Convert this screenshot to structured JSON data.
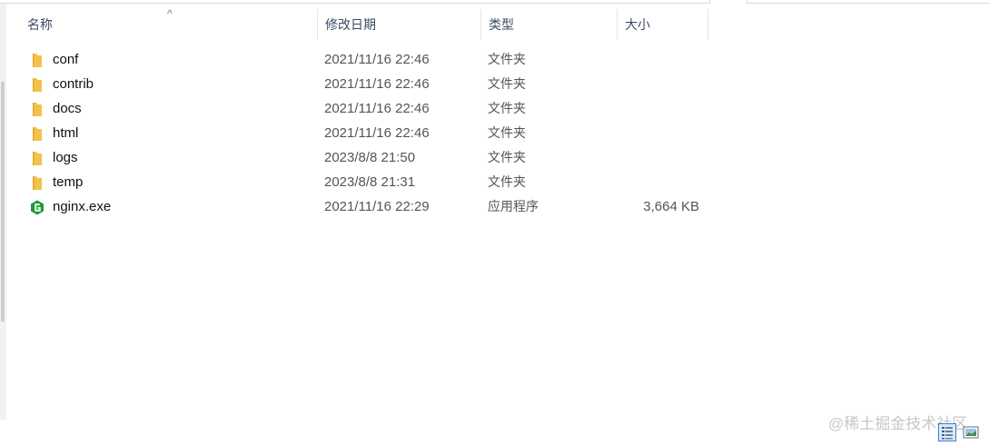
{
  "columns": {
    "name": "名称",
    "date_modified": "修改日期",
    "type": "类型",
    "size": "大小"
  },
  "sort_indicator": "^",
  "files": [
    {
      "name": "conf",
      "date": "2021/11/16 22:46",
      "type": "文件夹",
      "size": "",
      "icon": "folder-icon"
    },
    {
      "name": "contrib",
      "date": "2021/11/16 22:46",
      "type": "文件夹",
      "size": "",
      "icon": "folder-icon"
    },
    {
      "name": "docs",
      "date": "2021/11/16 22:46",
      "type": "文件夹",
      "size": "",
      "icon": "folder-icon"
    },
    {
      "name": "html",
      "date": "2021/11/16 22:46",
      "type": "文件夹",
      "size": "",
      "icon": "folder-icon"
    },
    {
      "name": "logs",
      "date": "2023/8/8 21:50",
      "type": "文件夹",
      "size": "",
      "icon": "folder-icon"
    },
    {
      "name": "temp",
      "date": "2023/8/8 21:31",
      "type": "文件夹",
      "size": "",
      "icon": "folder-icon"
    },
    {
      "name": "nginx.exe",
      "date": "2021/11/16 22:29",
      "type": "应用程序",
      "size": "3,664 KB",
      "icon": "nginx-icon"
    }
  ],
  "watermark": "@稀土掘金技术社区",
  "colors": {
    "folder": "#f3c24d",
    "nginx": "#1e9c35",
    "accent": "#3a7bd5"
  }
}
